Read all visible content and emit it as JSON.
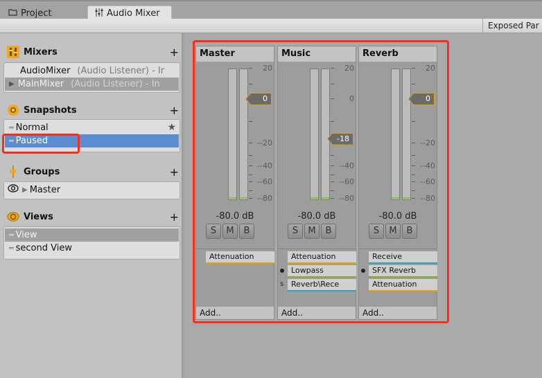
{
  "tabs": [
    {
      "label": "Project",
      "icon": "folder-icon",
      "active": false
    },
    {
      "label": "Audio Mixer",
      "icon": "mixer-sliders-icon",
      "active": true
    }
  ],
  "toolbar": {
    "exposed_params_label": "Exposed Par"
  },
  "sidebar": {
    "mixers": {
      "title": "Mixers",
      "add": "+",
      "items": [
        {
          "name": "AudioMixer",
          "detail": "(Audio Listener) - Ir",
          "selected": false
        },
        {
          "name": "MainMixer",
          "detail": "(Audio Listener) - In",
          "selected": true
        }
      ]
    },
    "snapshots": {
      "title": "Snapshots",
      "add": "+",
      "items": [
        {
          "name": "Normal",
          "starred": true,
          "selected": false
        },
        {
          "name": "Paused",
          "starred": false,
          "selected": true
        }
      ],
      "star_glyph": "★"
    },
    "groups": {
      "title": "Groups",
      "add": "+",
      "items": [
        {
          "name": "Master"
        }
      ]
    },
    "views": {
      "title": "Views",
      "add": "+",
      "items": [
        {
          "name": "View",
          "selected": true
        },
        {
          "name": "second View",
          "selected": false
        }
      ]
    }
  },
  "strips": [
    {
      "name": "Master",
      "fader_value": "0",
      "fader_db": 0,
      "level_text": "-80.0 dB",
      "buttons": [
        "S",
        "M",
        "B"
      ],
      "effects": [
        {
          "label": "Attenuation",
          "color": "#e9a200",
          "marker": ""
        }
      ],
      "add_label": "Add.."
    },
    {
      "name": "Music",
      "fader_value": "-18",
      "fader_db": -18,
      "level_text": "-80.0 dB",
      "buttons": [
        "S",
        "M",
        "B"
      ],
      "effects": [
        {
          "label": "Attenuation",
          "color": "#e9a200",
          "marker": ""
        },
        {
          "label": "Lowpass",
          "color": "#7fb025",
          "marker": "dot"
        },
        {
          "label": "Reverb\\Rece",
          "color": "#2aa3b8",
          "marker": "s"
        }
      ],
      "add_label": "Add.."
    },
    {
      "name": "Reverb",
      "fader_value": "0",
      "fader_db": 0,
      "level_text": "-80.0 dB",
      "buttons": [
        "S",
        "M",
        "B"
      ],
      "effects": [
        {
          "label": "Receive",
          "color": "#2aa3b8",
          "marker": ""
        },
        {
          "label": "SFX Reverb",
          "color": "#7fb025",
          "marker": "dot"
        },
        {
          "label": "Attenuation",
          "color": "#e9a200",
          "marker": ""
        }
      ],
      "add_label": "Add.."
    }
  ],
  "meter_scale": {
    "ticks": [
      {
        "db": 20,
        "label": "20"
      },
      {
        "db": 0,
        "label": "0"
      },
      {
        "db": -20,
        "label": "--20"
      },
      {
        "db": -40,
        "label": "--40"
      },
      {
        "db": -60,
        "label": "--60"
      },
      {
        "db": -80,
        "label": "--80"
      }
    ]
  },
  "colors": {
    "accent_orange": "#e9a200",
    "selection_blue": "#5a8dd2",
    "highlight_red": "#ff2a1a",
    "meter_green": "#8fc23a"
  }
}
